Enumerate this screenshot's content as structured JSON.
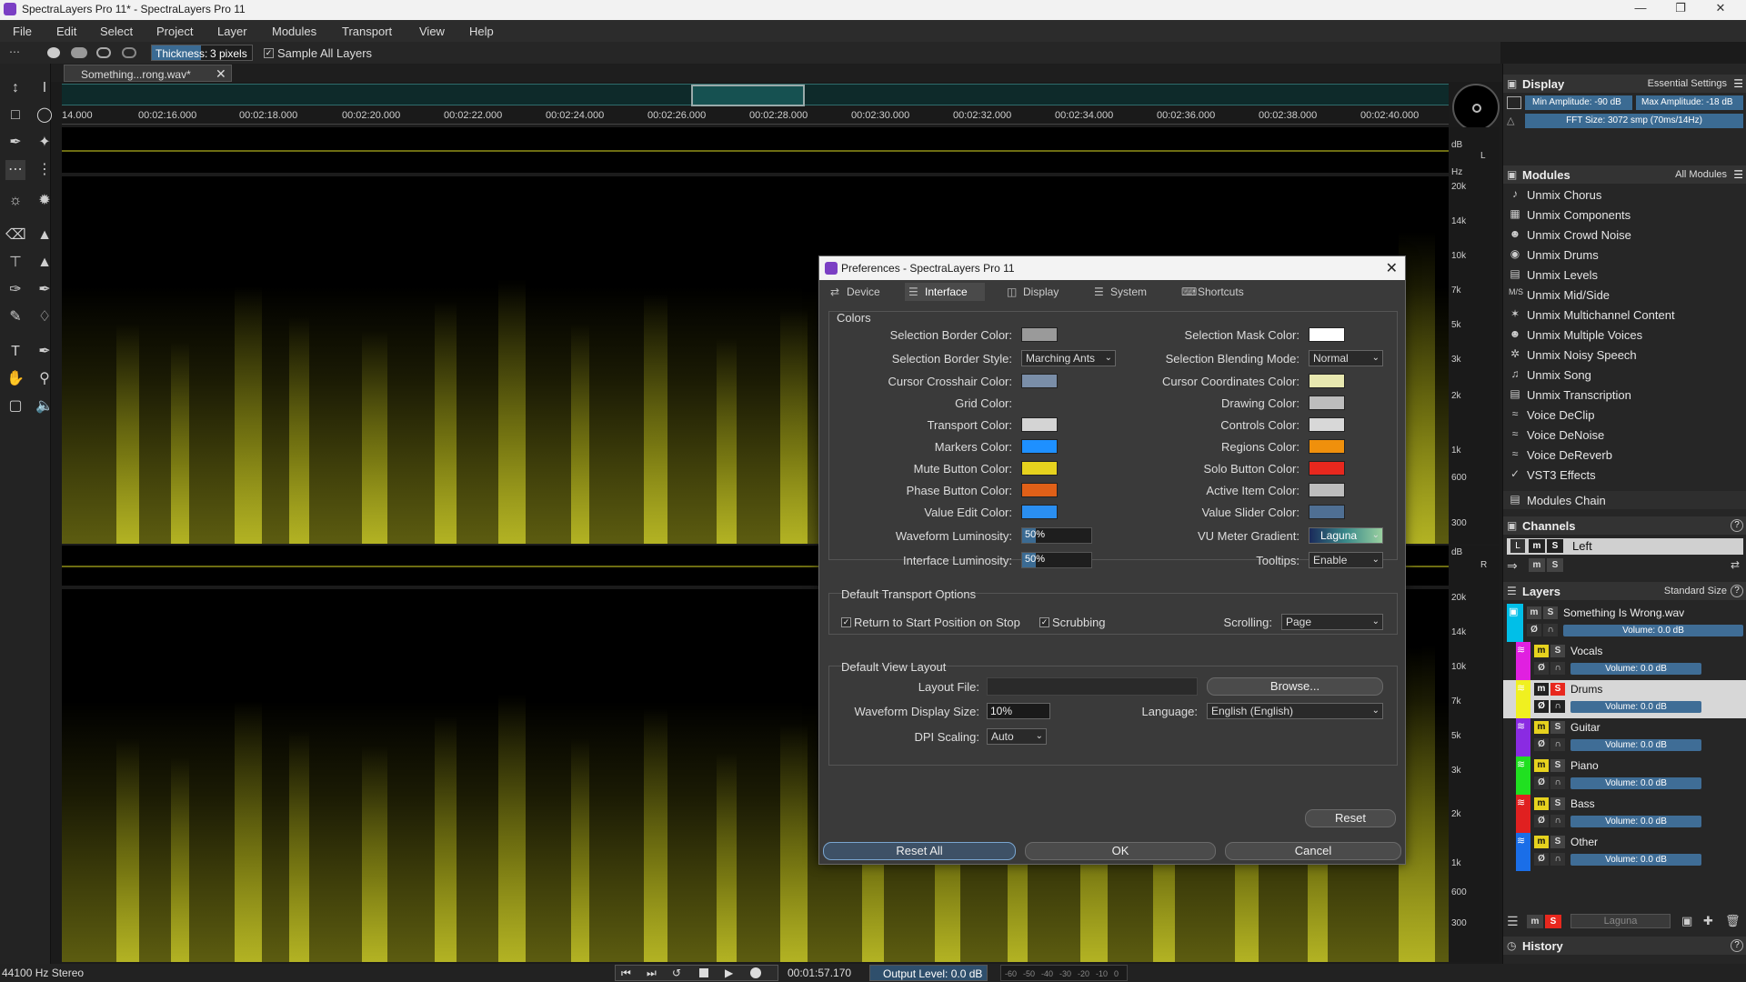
{
  "window": {
    "title": "SpectraLayers Pro 11* - SpectraLayers Pro 11",
    "controls": [
      "minimize-icon",
      "restore-icon",
      "close-icon"
    ]
  },
  "menu": [
    "File",
    "Edit",
    "Select",
    "Project",
    "Layer",
    "Modules",
    "Transport",
    "View",
    "Help"
  ],
  "tool_options": {
    "thickness_label": "Thickness:",
    "thickness_value": "3 pixels",
    "sample_all_layers": "Sample All Layers",
    "sample_all_checked": true
  },
  "document_tab": "Something...rong.wav*",
  "timeline": {
    "ticks": [
      "14.000",
      "00:02:16.000",
      "00:02:18.000",
      "00:02:20.000",
      "00:02:22.000",
      "00:02:24.000",
      "00:02:26.000",
      "00:02:28.000",
      "00:02:30.000",
      "00:02:32.000",
      "00:02:34.000",
      "00:02:36.000",
      "00:02:38.000",
      "00:02:40.000"
    ]
  },
  "freq_scale": {
    "unit_db": "dB",
    "unit_hz": "Hz",
    "channel_l": "L",
    "channel_r": "R",
    "labels": [
      "20k",
      "14k",
      "10k",
      "7k",
      "5k",
      "3k",
      "2k",
      "1k",
      "600",
      "300"
    ]
  },
  "right_panel": {
    "display": {
      "title": "Display",
      "preset": "Essential Settings",
      "min_amp": "Min Amplitude: -90 dB",
      "max_amp": "Max Amplitude: -18 dB",
      "fft": "FFT Size: 3072 smp (70ms/14Hz)"
    },
    "modules": {
      "title": "Modules",
      "filter": "All Modules",
      "items": [
        {
          "label": "Unmix Chorus",
          "icon": "chorus-icon"
        },
        {
          "label": "Unmix Components",
          "icon": "components-icon"
        },
        {
          "label": "Unmix Crowd Noise",
          "icon": "crowd-icon"
        },
        {
          "label": "Unmix Drums",
          "icon": "drums-icon"
        },
        {
          "label": "Unmix Levels",
          "icon": "levels-icon"
        },
        {
          "label": "Unmix Mid/Side",
          "icon": "midside-icon"
        },
        {
          "label": "Unmix Multichannel Content",
          "icon": "multichannel-icon"
        },
        {
          "label": "Unmix Multiple Voices",
          "icon": "voices-icon"
        },
        {
          "label": "Unmix Noisy Speech",
          "icon": "speech-icon"
        },
        {
          "label": "Unmix Song",
          "icon": "song-icon"
        },
        {
          "label": "Unmix Transcription",
          "icon": "transcription-icon"
        },
        {
          "label": "Voice DeClip",
          "icon": "declip-icon"
        },
        {
          "label": "Voice DeNoise",
          "icon": "denoise-icon"
        },
        {
          "label": "Voice DeReverb",
          "icon": "dereverb-icon"
        },
        {
          "label": "VST3 Effects",
          "icon": "vst3-icon"
        }
      ],
      "chain": "Modules Chain"
    },
    "channels": {
      "title": "Channels",
      "channel_l": "L",
      "channel_name": "Left"
    },
    "layers": {
      "title": "Layers",
      "size": "Standard Size",
      "items": [
        {
          "name": "Something Is Wrong.wav",
          "volume": "Volume: 0.0 dB",
          "color": "#00bfe8"
        },
        {
          "name": "Vocals",
          "volume": "Volume: 0.0 dB",
          "color": "#e020e0"
        },
        {
          "name": "Drums",
          "volume": "Volume: 0.0 dB",
          "color": "#f0f020"
        },
        {
          "name": "Guitar",
          "volume": "Volume: 0.0 dB",
          "color": "#8a2be2"
        },
        {
          "name": "Piano",
          "volume": "Volume: 0.0 dB",
          "color": "#20e020"
        },
        {
          "name": "Bass",
          "volume": "Volume: 0.0 dB",
          "color": "#e02020"
        },
        {
          "name": "Other",
          "volume": "Volume: 0.0 dB",
          "color": "#1a6ee8"
        }
      ],
      "gradient": "Laguna"
    },
    "history": {
      "title": "History"
    }
  },
  "status": {
    "sample_rate": "44100 Hz Stereo",
    "time": "00:01:57.170",
    "output_level": "Output Level: 0.0 dB",
    "meter_ticks": [
      "-60",
      "-50",
      "-40",
      "-30",
      "-20",
      "-10",
      "0"
    ]
  },
  "dialog": {
    "title": "Preferences - SpectraLayers Pro 11",
    "tabs": [
      {
        "label": "Device",
        "icon": "device-icon"
      },
      {
        "label": "Interface",
        "icon": "interface-icon"
      },
      {
        "label": "Display",
        "icon": "display-icon"
      },
      {
        "label": "System",
        "icon": "system-icon"
      },
      {
        "label": "Shortcuts",
        "icon": "shortcuts-icon"
      }
    ],
    "active_tab": "Interface",
    "colors_group": "Colors",
    "left_colors": [
      {
        "label": "Selection Border Color:",
        "color": "#9a9a9a"
      },
      {
        "label": "Selection Border Style:",
        "select": "Marching Ants"
      },
      {
        "label": "Cursor Crosshair Color:",
        "color": "#7a8ea8"
      },
      {
        "label": "Grid Color:",
        "color": ""
      },
      {
        "label": "Transport Color:",
        "color": "#d4d4d4"
      },
      {
        "label": "Markers Color:",
        "color": "#1e90ff"
      },
      {
        "label": "Mute Button Color:",
        "color": "#e6d21e"
      },
      {
        "label": "Phase Button Color:",
        "color": "#e06018"
      },
      {
        "label": "Value Edit Color:",
        "color": "#2a8ef0"
      }
    ],
    "right_colors": [
      {
        "label": "Selection Mask Color:",
        "color": "#ffffff"
      },
      {
        "label": "Selection Blending Mode:",
        "select": "Normal"
      },
      {
        "label": "Cursor Coordinates Color:",
        "color": "#e8e8b0"
      },
      {
        "label": "Drawing Color:",
        "color": "#bdbdbd"
      },
      {
        "label": "Controls Color:",
        "color": "#d8d8d8"
      },
      {
        "label": "Regions Color:",
        "color": "#f0900c"
      },
      {
        "label": "Solo Button Color:",
        "color": "#e8281e"
      },
      {
        "label": "Active Item Color:",
        "color": "#bdbdbd"
      },
      {
        "label": "Value Slider Color:",
        "color": "#4f6f93"
      }
    ],
    "waveform_luminosity_label": "Waveform Luminosity:",
    "waveform_luminosity": "50%",
    "waveform_luminosity_pct": 50,
    "interface_luminosity_label": "Interface Luminosity:",
    "interface_luminosity": "50%",
    "interface_luminosity_pct": 50,
    "vu_label": "VU Meter Gradient:",
    "vu_value": "Laguna",
    "tooltips_label": "Tooltips:",
    "tooltips_value": "Enable",
    "transport_group": "Default Transport Options",
    "return_start": "Return to Start Position on Stop",
    "scrubbing": "Scrubbing",
    "scrolling_label": "Scrolling:",
    "scrolling_value": "Page",
    "layout_group": "Default View Layout",
    "layout_file_label": "Layout File:",
    "layout_file_value": "",
    "browse": "Browse...",
    "waveform_size_label": "Waveform Display Size:",
    "waveform_size_value": "10%",
    "language_label": "Language:",
    "language_value": "English (English)",
    "dpi_label": "DPI Scaling:",
    "dpi_value": "Auto",
    "reset": "Reset",
    "reset_all": "Reset All",
    "ok": "OK",
    "cancel": "Cancel"
  }
}
